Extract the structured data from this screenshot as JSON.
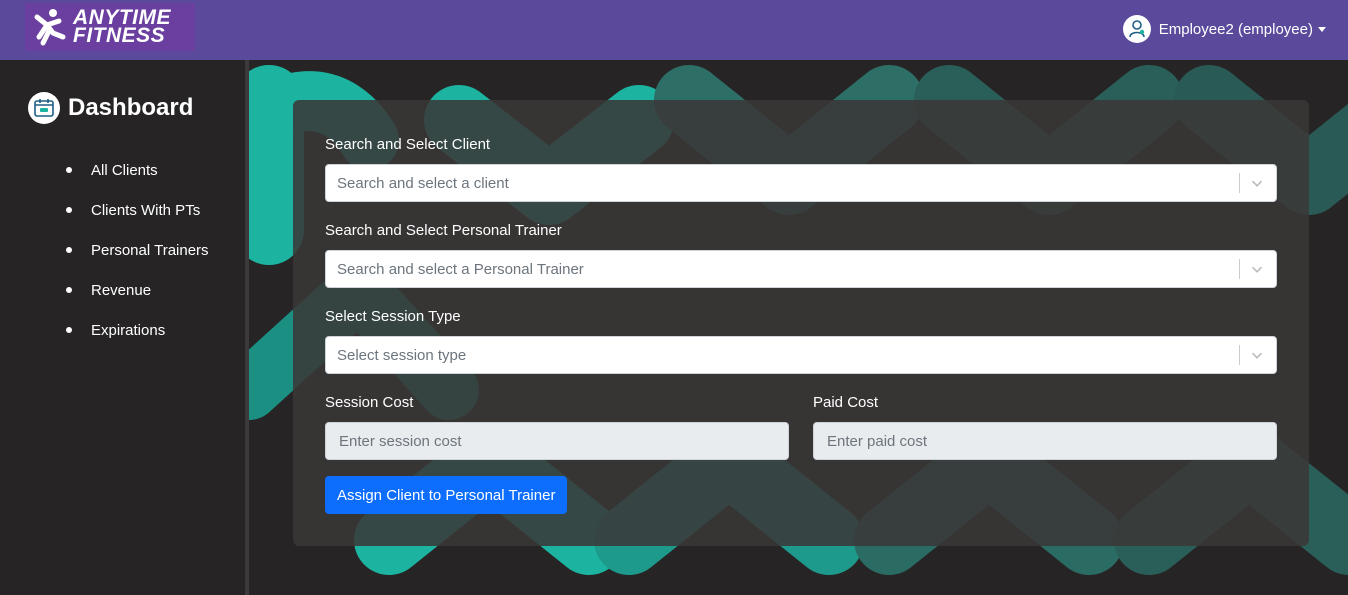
{
  "colors": {
    "navbar": "#5b4a9b",
    "logo_bg": "#6a3fa0",
    "page_bg": "#262424",
    "accent_teal": "#1cb3a0",
    "primary_button": "#0d6efd"
  },
  "header": {
    "logo_line1": "ANYTIME",
    "logo_line2": "FITNESS",
    "user_label": "Employee2 (employee)",
    "avatar_icon": "user-avatar-icon",
    "caret_icon": "caret-down-icon"
  },
  "sidebar": {
    "title": "Dashboard",
    "title_icon": "dashboard-calendar-icon",
    "items": [
      {
        "label": "All Clients"
      },
      {
        "label": "Clients With PTs"
      },
      {
        "label": "Personal Trainers"
      },
      {
        "label": "Revenue"
      },
      {
        "label": "Expirations"
      }
    ]
  },
  "form": {
    "client": {
      "label": "Search and Select Client",
      "placeholder": "Search and select a client"
    },
    "trainer": {
      "label": "Search and Select Personal Trainer",
      "placeholder": "Search and select a Personal Trainer"
    },
    "session_type": {
      "label": "Select Session Type",
      "placeholder": "Select session type"
    },
    "session_cost": {
      "label": "Session Cost",
      "placeholder": "Enter session cost"
    },
    "paid_cost": {
      "label": "Paid Cost",
      "placeholder": "Enter paid cost"
    },
    "submit_label": "Assign Client to Personal Trainer"
  }
}
